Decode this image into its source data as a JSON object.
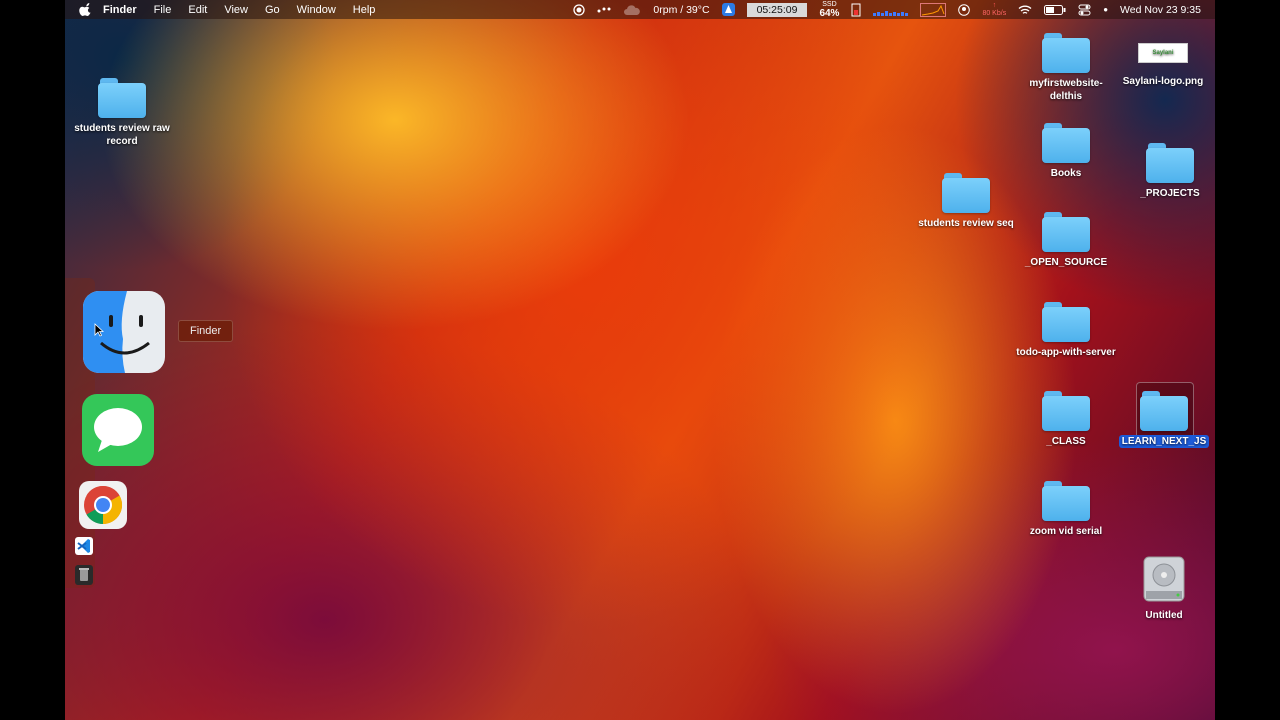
{
  "menubar": {
    "app_name": "Finder",
    "menus": [
      "File",
      "Edit",
      "View",
      "Go",
      "Window",
      "Help"
    ],
    "fan_temp": "0rpm / 39°C",
    "timer": "05:25:09",
    "ssd_label": "SSD",
    "ssd_value": "64%",
    "net_speed": "80 Kb/s",
    "datetime": "Wed Nov 23  9:35"
  },
  "desktop": {
    "left_folder": {
      "name": "students review raw record"
    },
    "middle_folder": {
      "name": "students review seq"
    },
    "col1": [
      {
        "name": "myfirstwebsite-delthis"
      },
      {
        "name": "Books"
      },
      {
        "name": "_OPEN_SOURCE"
      },
      {
        "name": "todo-app-with-server"
      },
      {
        "name": "_CLASS"
      },
      {
        "name": "zoom vid serial"
      }
    ],
    "col2": {
      "png_file": "Saylani-logo.png",
      "png_thumb_text": "Saylani",
      "projects": "_PROJECTS",
      "selected_folder": "LEARN_NEXT_JS",
      "drive": "Untitled"
    }
  },
  "dock": {
    "tooltip": "Finder",
    "apps": [
      "finder-icon",
      "messages-icon",
      "chrome-icon",
      "vscode-icon",
      "trash-icon"
    ]
  },
  "colors": {
    "folder": "#5fb8f0",
    "selection": "#1d5bd8"
  }
}
